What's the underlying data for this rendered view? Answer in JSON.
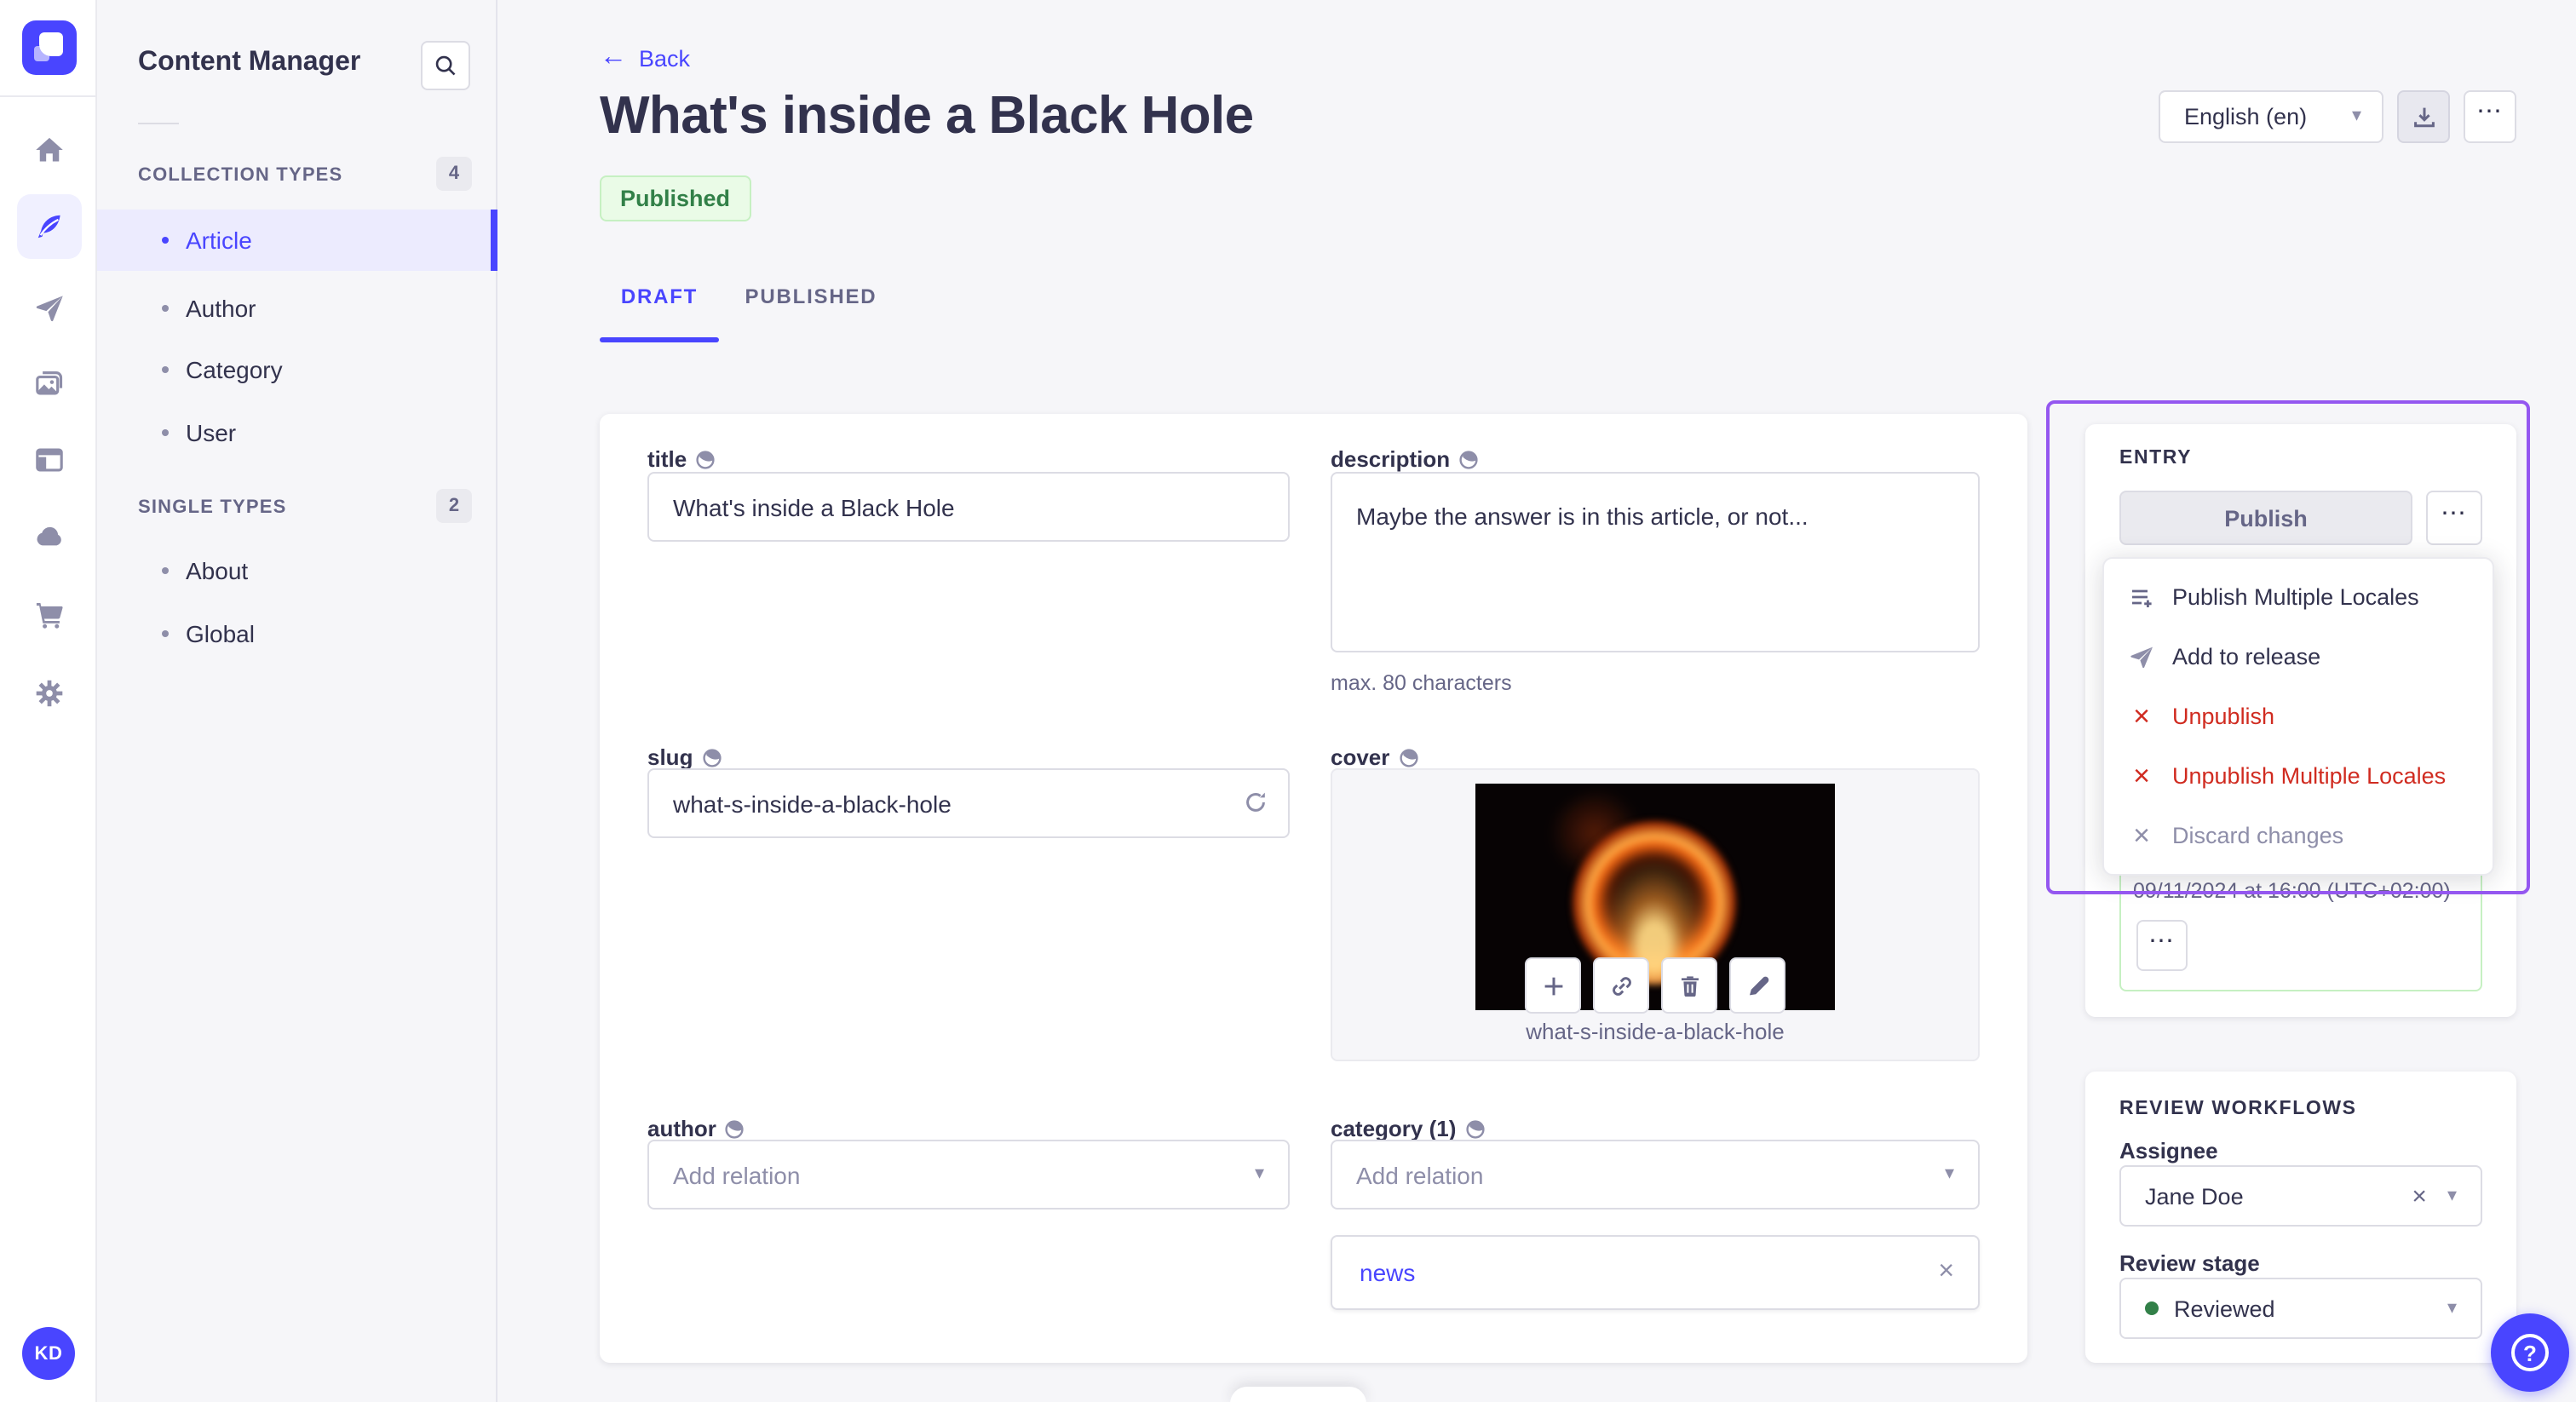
{
  "rail": {
    "avatar_initials": "KD",
    "icons": [
      "strapi-logo",
      "home-icon",
      "content-manager-feather-icon",
      "releases-paper-plane-icon",
      "media-library-icon",
      "content-type-builder-icon",
      "cloud-icon",
      "marketplace-cart-icon",
      "settings-gear-icon"
    ]
  },
  "subnav": {
    "title": "Content Manager",
    "sections": [
      {
        "label": "COLLECTION TYPES",
        "count": "4",
        "items": [
          {
            "label": "Article"
          },
          {
            "label": "Author"
          },
          {
            "label": "Category"
          },
          {
            "label": "User"
          }
        ]
      },
      {
        "label": "SINGLE TYPES",
        "count": "2",
        "items": [
          {
            "label": "About"
          },
          {
            "label": "Global"
          }
        ]
      }
    ]
  },
  "header": {
    "back_label": "Back",
    "title": "What's inside a Black Hole",
    "status_badge": "Published",
    "locale_selector": "English (en)",
    "tabs": [
      {
        "label": "DRAFT"
      },
      {
        "label": "PUBLISHED"
      }
    ]
  },
  "form": {
    "title": {
      "label": "title",
      "value": "What's inside a Black Hole"
    },
    "description": {
      "label": "description",
      "value": "Maybe the answer is in this article, or not...",
      "helper": "max. 80 characters"
    },
    "slug": {
      "label": "slug",
      "value": "what-s-inside-a-black-hole"
    },
    "cover": {
      "label": "cover",
      "caption": "what-s-inside-a-black-hole"
    },
    "author": {
      "label": "author",
      "placeholder": "Add relation"
    },
    "category": {
      "label": "category (1)",
      "placeholder": "Add relation",
      "relation": "news"
    }
  },
  "entry_panel": {
    "heading": "ENTRY",
    "publish_button": "Publish",
    "menu_items": [
      {
        "label": "Publish Multiple Locales",
        "icon": "list-plus-icon"
      },
      {
        "label": "Add to release",
        "icon": "paper-plane-icon"
      },
      {
        "label": "Unpublish",
        "icon": "cross-icon",
        "variant": "danger"
      },
      {
        "label": "Unpublish Multiple Locales",
        "icon": "cross-icon",
        "variant": "danger"
      },
      {
        "label": "Discard changes",
        "icon": "cross-icon",
        "variant": "disabled"
      }
    ],
    "scheduled_date": "09/11/2024 at 16:00 (UTC+02:00)"
  },
  "review_panel": {
    "heading": "REVIEW WORKFLOWS",
    "assignee_label": "Assignee",
    "assignee_value": "Jane Doe",
    "stage_label": "Review stage",
    "stage_value": "Reviewed"
  },
  "colors": {
    "accent": "#4945ff",
    "danger": "#d02b20",
    "success": "#328048",
    "highlight_outline": "#9457f0",
    "stage_dot": "#328048"
  }
}
